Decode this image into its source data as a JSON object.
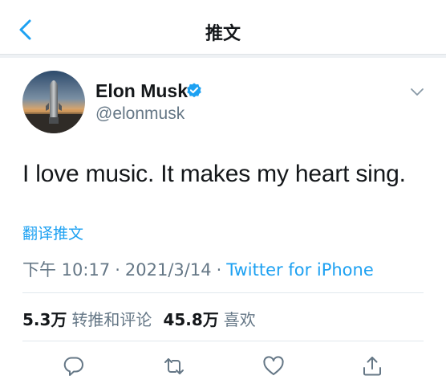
{
  "header": {
    "title": "推文",
    "back_icon": "chevron-left-icon"
  },
  "author": {
    "display_name": "Elon Musk",
    "handle": "@elonmusk",
    "verified": true,
    "avatar": "avatar-image"
  },
  "tweet": {
    "text": "I love music. It makes my heart sing.",
    "translate_label": "翻译推文"
  },
  "meta": {
    "time": "下午 10:17",
    "separator": "·",
    "date": "2021/3/14",
    "source": "Twitter for iPhone"
  },
  "stats": {
    "retweets_count": "5.3万",
    "retweets_label": "转推和评论",
    "likes_count": "45.8万",
    "likes_label": "喜欢"
  },
  "actions": [
    {
      "icon": "reply-icon"
    },
    {
      "icon": "retweet-icon"
    },
    {
      "icon": "like-icon"
    },
    {
      "icon": "share-icon"
    }
  ],
  "colors": {
    "accent": "#1da1f2",
    "text_primary": "#14171a",
    "text_secondary": "#657786",
    "divider": "#e1e8ed"
  }
}
